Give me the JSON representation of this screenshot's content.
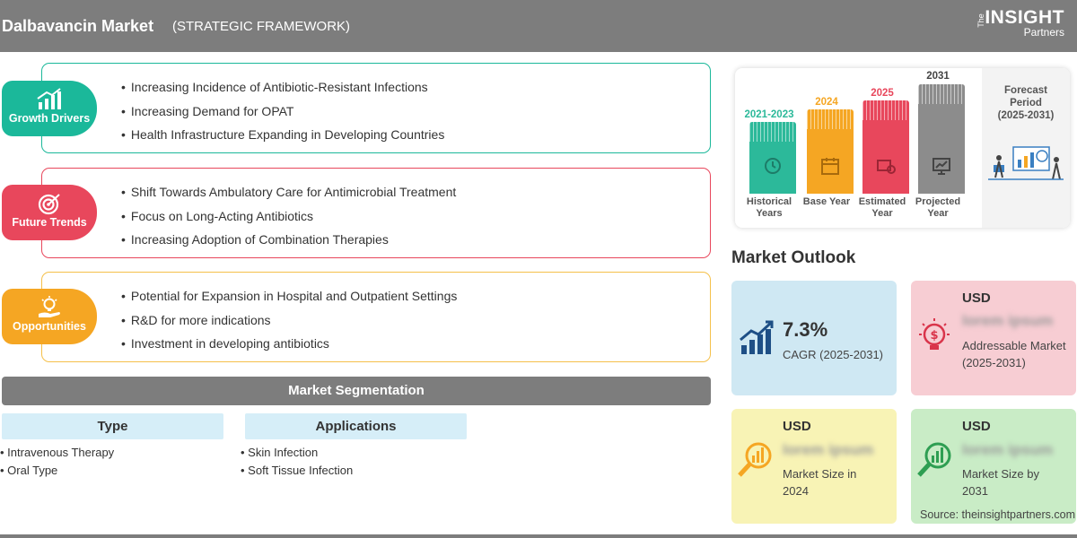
{
  "header": {
    "title": "Dalbavancin Market",
    "subtitle": "(STRATEGIC FRAMEWORK)",
    "logo_the": "The",
    "logo_main": "INSIGHT",
    "logo_sub": "Partners"
  },
  "panels": [
    {
      "label": "Growth Drivers",
      "color": "#1bb89a",
      "border": "#1bb89a",
      "icon": "bar-growth-icon",
      "items": [
        "Increasing Incidence of Antibiotic-Resistant Infections",
        "Increasing Demand for OPAT",
        "Health Infrastructure Expanding in Developing Countries"
      ]
    },
    {
      "label": "Future Trends",
      "color": "#e8475c",
      "border": "#e8475c",
      "icon": "target-icon",
      "items": [
        "Shift Towards Ambulatory Care for Antimicrobial Treatment",
        "Focus on Long-Acting Antibiotics",
        "Increasing Adoption of Combination Therapies"
      ]
    },
    {
      "label": "Opportunities",
      "color": "#f5a623",
      "border": "#f5c04a",
      "icon": "lightbulb-hand-icon",
      "items": [
        "Potential for Expansion in Hospital and Outpatient Settings",
        "R&D for more indications",
        "Investment in developing antibiotics"
      ]
    }
  ],
  "segmentation": {
    "title": "Market Segmentation",
    "groups": [
      {
        "title": "Type",
        "items": [
          "Intravenous Therapy",
          "Oral Type"
        ]
      },
      {
        "title": "Applications",
        "items": [
          "Skin Infection",
          "Soft Tissue Infection"
        ]
      }
    ]
  },
  "timeline": {
    "columns": [
      {
        "year": "2021-2023",
        "caption": "Historical Years",
        "color": "#2cb99a",
        "icon": "history-icon"
      },
      {
        "year": "2024",
        "caption": "Base Year",
        "color": "#f5a623",
        "icon": "calendar-icon"
      },
      {
        "year": "2025",
        "caption": "Estimated Year",
        "color": "#e8475c",
        "icon": "estimate-icon"
      },
      {
        "year": "2031",
        "caption": "Projected Year",
        "color": "#8c8c8c",
        "icon": "projection-icon"
      }
    ],
    "forecast_label": "Forecast Period",
    "forecast_range": "(2025-2031)"
  },
  "outlook": {
    "title": "Market Outlook",
    "cagr": {
      "value": "7.3%",
      "label": "CAGR (2025-2031)",
      "bg": "#cfe8f3"
    },
    "addressable": {
      "currency": "USD",
      "value": "lorem ipsum",
      "label": "Addressable Market (2025-2031)",
      "bg": "#f7cdd3"
    },
    "size_2024": {
      "currency": "USD",
      "value": "lorem ipsum",
      "label": "Market Size in 2024",
      "bg": "#f8f3b5"
    },
    "size_2031": {
      "currency": "USD",
      "value": "lorem ipsum",
      "label": "Market Size by 2031",
      "bg": "#c9ecc6"
    }
  },
  "source": "Source: theinsightpartners.com"
}
